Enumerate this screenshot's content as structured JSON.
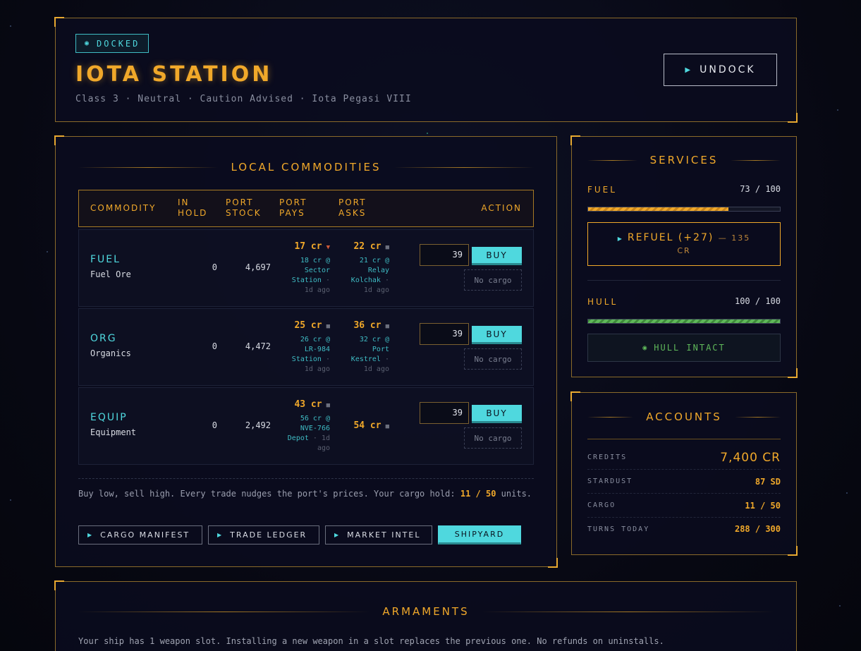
{
  "header": {
    "status_badge": "DOCKED",
    "station_name": "IOTA STATION",
    "subtitle": "Class 3 · Neutral · Caution Advised · Iota Pegasi VIII",
    "undock_label": "UNDOCK"
  },
  "commodities": {
    "title": "LOCAL COMMODITIES",
    "columns": {
      "commodity": "COMMODITY",
      "in_hold_1": "IN",
      "in_hold_2": "HOLD",
      "port_stock_1": "PORT",
      "port_stock_2": "STOCK",
      "port_pays_1": "PORT",
      "port_pays_2": "PAYS",
      "port_asks_1": "PORT",
      "port_asks_2": "ASKS",
      "action": "ACTION"
    },
    "rows": [
      {
        "code": "FUEL",
        "name": "Fuel Ore",
        "hold": "0",
        "stock": "4,697",
        "pays": "17 cr",
        "pays_ref_1": "18 cr @",
        "pays_ref_2": "Sector",
        "pays_ref_3": "Station",
        "pays_ago": "1d ago",
        "asks": "22 cr",
        "asks_ref_1": "21 cr @",
        "asks_ref_2": "Relay",
        "asks_ref_3": "Kolchak",
        "asks_ago": "1d ago",
        "qty": "39",
        "buy": "BUY",
        "sell": "No cargo"
      },
      {
        "code": "ORG",
        "name": "Organics",
        "hold": "0",
        "stock": "4,472",
        "pays": "25 cr",
        "pays_ref_1": "26 cr @",
        "pays_ref_2": "LR-984",
        "pays_ref_3": "Station",
        "pays_ago": "1d ago",
        "asks": "36 cr",
        "asks_ref_1": "32 cr @",
        "asks_ref_2": "Port",
        "asks_ref_3": "Kestrel",
        "asks_ago": "1d ago",
        "qty": "39",
        "buy": "BUY",
        "sell": "No cargo"
      },
      {
        "code": "EQUIP",
        "name": "Equipment",
        "hold": "0",
        "stock": "2,492",
        "pays": "43 cr",
        "pays_ref_1": "56 cr @",
        "pays_ref_2": "NVE-766",
        "pays_ref_3": "Depot",
        "pays_ago_a": "1d",
        "pays_ago_b": "ago",
        "asks": "54 cr",
        "qty": "39",
        "buy": "BUY",
        "sell": "No cargo"
      }
    ],
    "note_text": "Buy low, sell high. Every trade nudges the port's prices. Your cargo hold:",
    "note_cargo": "11 / 50",
    "note_units": "units.",
    "nav": [
      "CARGO MANIFEST",
      "TRADE LEDGER",
      "MARKET INTEL",
      "SHIPYARD"
    ]
  },
  "services": {
    "title": "SERVICES",
    "fuel_label": "FUEL",
    "fuel_value": "73 / 100",
    "fuel_fraction": 0.73,
    "refuel_label": "REFUEL (+27)",
    "refuel_cost_1": "— 135",
    "refuel_cost_2": "CR",
    "hull_label": "HULL",
    "hull_value": "100 / 100",
    "hull_fraction": 1.0,
    "hull_status": "HULL INTACT"
  },
  "accounts": {
    "title": "ACCOUNTS",
    "rows": [
      {
        "key": "CREDITS",
        "value": "7,400 CR"
      },
      {
        "key": "STARDUST",
        "value": "87 SD"
      },
      {
        "key": "CARGO",
        "value": "11 / 50"
      },
      {
        "key": "TURNS TODAY",
        "value": "288 / 300"
      }
    ]
  },
  "armaments": {
    "title": "ARMAMENTS",
    "note": "Your ship has 1 weapon slot. Installing a new weapon in a slot replaces the previous one. No refunds on uninstalls."
  },
  "colors": {
    "accent_gold": "#f0a82a",
    "accent_cyan": "#4fd8de",
    "hull_green": "#5fb85a"
  }
}
